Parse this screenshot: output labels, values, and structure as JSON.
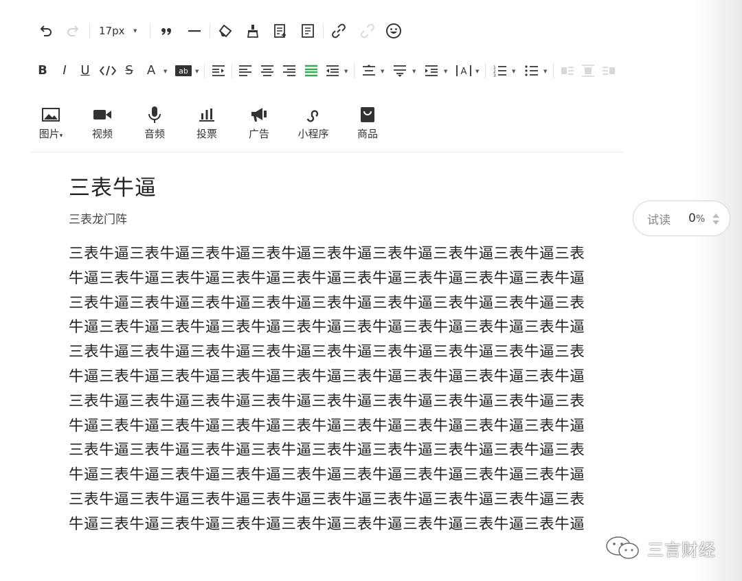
{
  "toolbar": {
    "font_size": "17px"
  },
  "media_bar": {
    "items": [
      {
        "label": "图片",
        "icon": "image-icon"
      },
      {
        "label": "视频",
        "icon": "video-icon"
      },
      {
        "label": "音频",
        "icon": "microphone-icon"
      },
      {
        "label": "投票",
        "icon": "poll-icon"
      },
      {
        "label": "广告",
        "icon": "megaphone-icon"
      },
      {
        "label": "小程序",
        "icon": "mini-program-icon"
      },
      {
        "label": "商品",
        "icon": "shopping-bag-icon"
      }
    ]
  },
  "article": {
    "title": "三表牛逼",
    "author": "三表龙门阵",
    "body": "三表牛逼三表牛逼三表牛逼三表牛逼三表牛逼三表牛逼三表牛逼三表牛逼三表牛逼三表牛逼三表牛逼三表牛逼三表牛逼三表牛逼三表牛逼三表牛逼三表牛逼三表牛逼三表牛逼三表牛逼三表牛逼三表牛逼三表牛逼三表牛逼三表牛逼三表牛逼三表牛逼三表牛逼三表牛逼三表牛逼三表牛逼三表牛逼三表牛逼三表牛逼三表牛逼三表牛逼三表牛逼三表牛逼三表牛逼三表牛逼三表牛逼三表牛逼三表牛逼三表牛逼三表牛逼三表牛逼三表牛逼三表牛逼三表牛逼三表牛逼三表牛逼三表牛逼三表牛逼三表牛逼三表牛逼三表牛逼三表牛逼三表牛逼三表牛逼三表牛逼三表牛逼三表牛逼三表牛逼三表牛逼三表牛逼三表牛逼三表牛逼三表牛逼三表牛逼三表牛逼三表牛逼三表牛逼三表牛逼三表牛逼三表牛逼三表牛逼三表牛逼三表牛逼三表牛逼三表牛逼三表牛逼三表牛逼三表牛逼三表牛逼三表牛逼三表牛逼三表牛逼三表牛逼三表牛逼三表牛逼三表牛逼三表牛逼三表牛逼三表牛逼三表牛逼三表牛逼三表牛逼三表牛逼三表牛逼三表牛逼三表牛逼三表牛逼"
  },
  "preview": {
    "label": "试读",
    "value": "0",
    "unit": "%"
  },
  "watermark": {
    "text": "三言财经"
  },
  "colors": {
    "active_align": "#3aa757",
    "icon": "#333333",
    "disabled": "#cccccc"
  }
}
